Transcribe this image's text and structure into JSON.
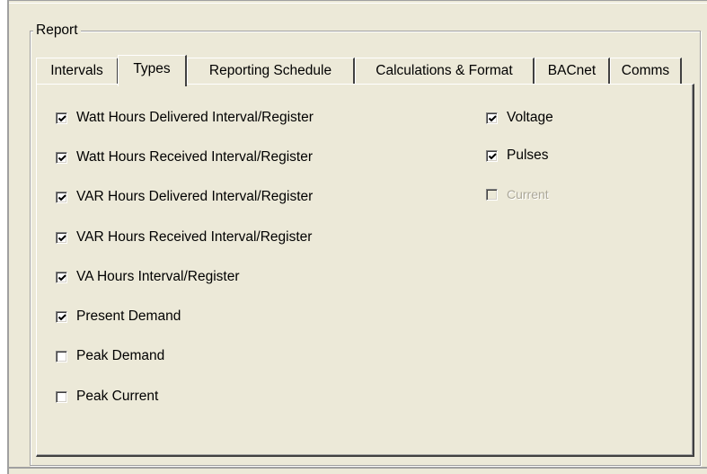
{
  "group": {
    "title": "Report"
  },
  "tabs": [
    {
      "label": "Intervals",
      "active": false
    },
    {
      "label": "Types",
      "active": true
    },
    {
      "label": "Reporting Schedule",
      "active": false
    },
    {
      "label": "Calculations & Format",
      "active": false
    },
    {
      "label": "BACnet",
      "active": false
    },
    {
      "label": "Comms",
      "active": false
    }
  ],
  "checkboxes": [
    {
      "label": "Watt Hours Delivered Interval/Register",
      "checked": true,
      "enabled": true
    },
    {
      "label": "Watt Hours Received Interval/Register",
      "checked": true,
      "enabled": true
    },
    {
      "label": "VAR Hours Delivered Interval/Register",
      "checked": true,
      "enabled": true
    },
    {
      "label": "VAR Hours Received Interval/Register",
      "checked": true,
      "enabled": true
    },
    {
      "label": "VA Hours Interval/Register",
      "checked": true,
      "enabled": true
    },
    {
      "label": "Present Demand",
      "checked": true,
      "enabled": true
    },
    {
      "label": "Peak Demand",
      "checked": false,
      "enabled": true
    },
    {
      "label": "Peak Current",
      "checked": false,
      "enabled": true
    },
    {
      "label": "Voltage",
      "checked": true,
      "enabled": true
    },
    {
      "label": "Pulses",
      "checked": true,
      "enabled": true
    },
    {
      "label": "Current",
      "checked": false,
      "enabled": false
    }
  ]
}
